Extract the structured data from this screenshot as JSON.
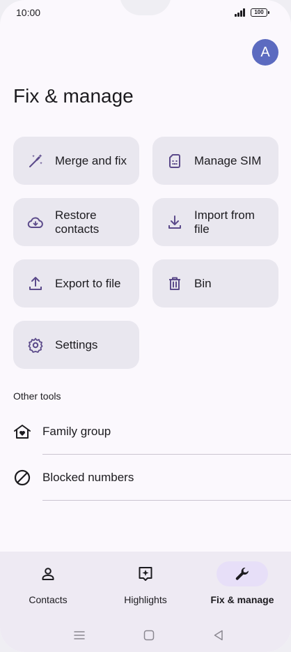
{
  "status_bar": {
    "time": "10:00",
    "battery": "100"
  },
  "header": {
    "avatar_letter": "A",
    "title": "Fix & manage"
  },
  "tiles": [
    {
      "label": "Merge and fix",
      "icon": "magic-wand-icon"
    },
    {
      "label": "Manage SIM",
      "icon": "sim-card-icon"
    },
    {
      "label": "Restore contacts",
      "icon": "cloud-restore-icon"
    },
    {
      "label": "Import from file",
      "icon": "download-icon"
    },
    {
      "label": "Export to file",
      "icon": "upload-icon"
    },
    {
      "label": "Bin",
      "icon": "trash-icon"
    },
    {
      "label": "Settings",
      "icon": "gear-icon"
    }
  ],
  "other_tools": {
    "heading": "Other tools",
    "items": [
      {
        "label": "Family group",
        "icon": "family-home-icon"
      },
      {
        "label": "Blocked numbers",
        "icon": "block-icon"
      }
    ]
  },
  "bottom_nav": {
    "items": [
      {
        "label": "Contacts",
        "icon": "person-icon",
        "active": false
      },
      {
        "label": "Highlights",
        "icon": "highlights-icon",
        "active": false
      },
      {
        "label": "Fix & manage",
        "icon": "wrench-icon",
        "active": true
      }
    ]
  },
  "system_nav": {
    "icons": [
      "menu-icon",
      "home-icon",
      "back-icon"
    ]
  },
  "colors": {
    "accent": "#5c6bc0",
    "icon_purple": "#5b4a8a",
    "tile_bg": "#e9e7ef",
    "active_pill": "#e7dff8"
  }
}
